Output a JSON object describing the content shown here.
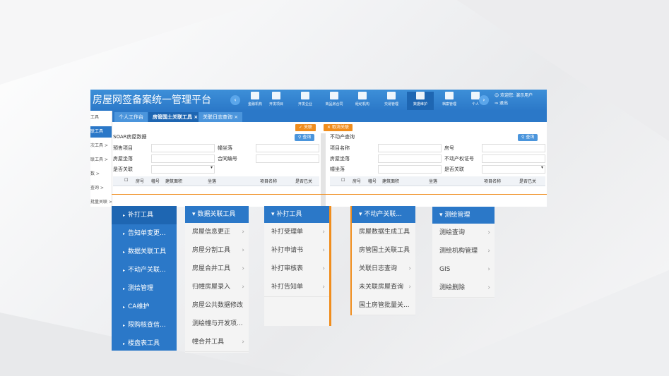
{
  "app": {
    "title": "房屋网签备案统一管理平台",
    "modules": [
      {
        "label": "金融机构",
        "icon": "building-icon"
      },
      {
        "label": "开发项目",
        "icon": "monitor-icon"
      },
      {
        "label": "开发企业",
        "icon": "building-icon"
      },
      {
        "label": "商品房合同",
        "icon": "document-icon"
      },
      {
        "label": "经纪机构",
        "icon": "building-icon"
      },
      {
        "label": "交易管理",
        "icon": "handshake-icon"
      },
      {
        "label": "数据维护",
        "icon": "database-icon"
      },
      {
        "label": "档案管理",
        "icon": "archive-icon"
      },
      {
        "label": "个人",
        "icon": "person-icon"
      }
    ],
    "user": {
      "welcome": "欢迎您: 演示用户",
      "logout": "退出"
    }
  },
  "tabs": [
    {
      "label": "个人工作台"
    },
    {
      "label": "房管国土关联工具 ×"
    },
    {
      "label": "关联日志查询 ×"
    }
  ],
  "sidebar": {
    "items": [
      "工具",
      "联工具",
      "次工具 >",
      "联工具 >",
      "数 >",
      "查询 >",
      "批量关联 >"
    ]
  },
  "actions": {
    "associate": "关联",
    "cancel_associate": "取消关联"
  },
  "left_pane": {
    "title": "SOAR房屋数据",
    "search": "查询",
    "fields": [
      {
        "label": "预售项目",
        "label2": "幢坐落"
      },
      {
        "label": "房屋坐落",
        "label2": "合同编号"
      },
      {
        "label": "是否关联",
        "label2": ""
      }
    ],
    "columns": [
      "房号",
      "幢号",
      "建筑面积",
      "坐落",
      "项目名称",
      "是否已关"
    ]
  },
  "right_pane": {
    "title": "不动产查询",
    "search": "查询",
    "fields": [
      {
        "label": "项目名称",
        "label2": "房号"
      },
      {
        "label": "房屋坐落",
        "label2": "不动产权证号"
      },
      {
        "label": "幢坐落",
        "label2": "是否关联"
      }
    ],
    "columns": [
      "房号",
      "幢号",
      "建筑面积",
      "坐落",
      "项目名称",
      "是否已关"
    ]
  },
  "main_menu": {
    "items": [
      "补打工具",
      "告知单变更...",
      "数据关联工具",
      "不动产关联...",
      "测绘管理",
      "CA维护",
      "限购核查信...",
      "楼盘表工具"
    ]
  },
  "menu_data_link": {
    "header": "数据关联工具",
    "items": [
      "房屋信息更正",
      "房屋分割工具",
      "房屋合并工具",
      "归幢房屋录入",
      "房屋公共数据修改",
      "测绘幢与开发项...",
      "幢合并工具"
    ]
  },
  "menu_reprint": {
    "header": "补打工具",
    "items": [
      "补打受理单",
      "补打申请书",
      "补打审核表",
      "补打告知单"
    ]
  },
  "menu_realestate": {
    "header": "不动产关联...",
    "items": [
      "房屋数据生成工具",
      "房管国土关联工具",
      "关联日志查询",
      "未关联房屋查询",
      "国土房管批量关..."
    ]
  },
  "menu_survey": {
    "header": "测绘管理",
    "items": [
      "测绘查询",
      "测绘机构管理",
      "GIS",
      "测绘删除"
    ]
  }
}
